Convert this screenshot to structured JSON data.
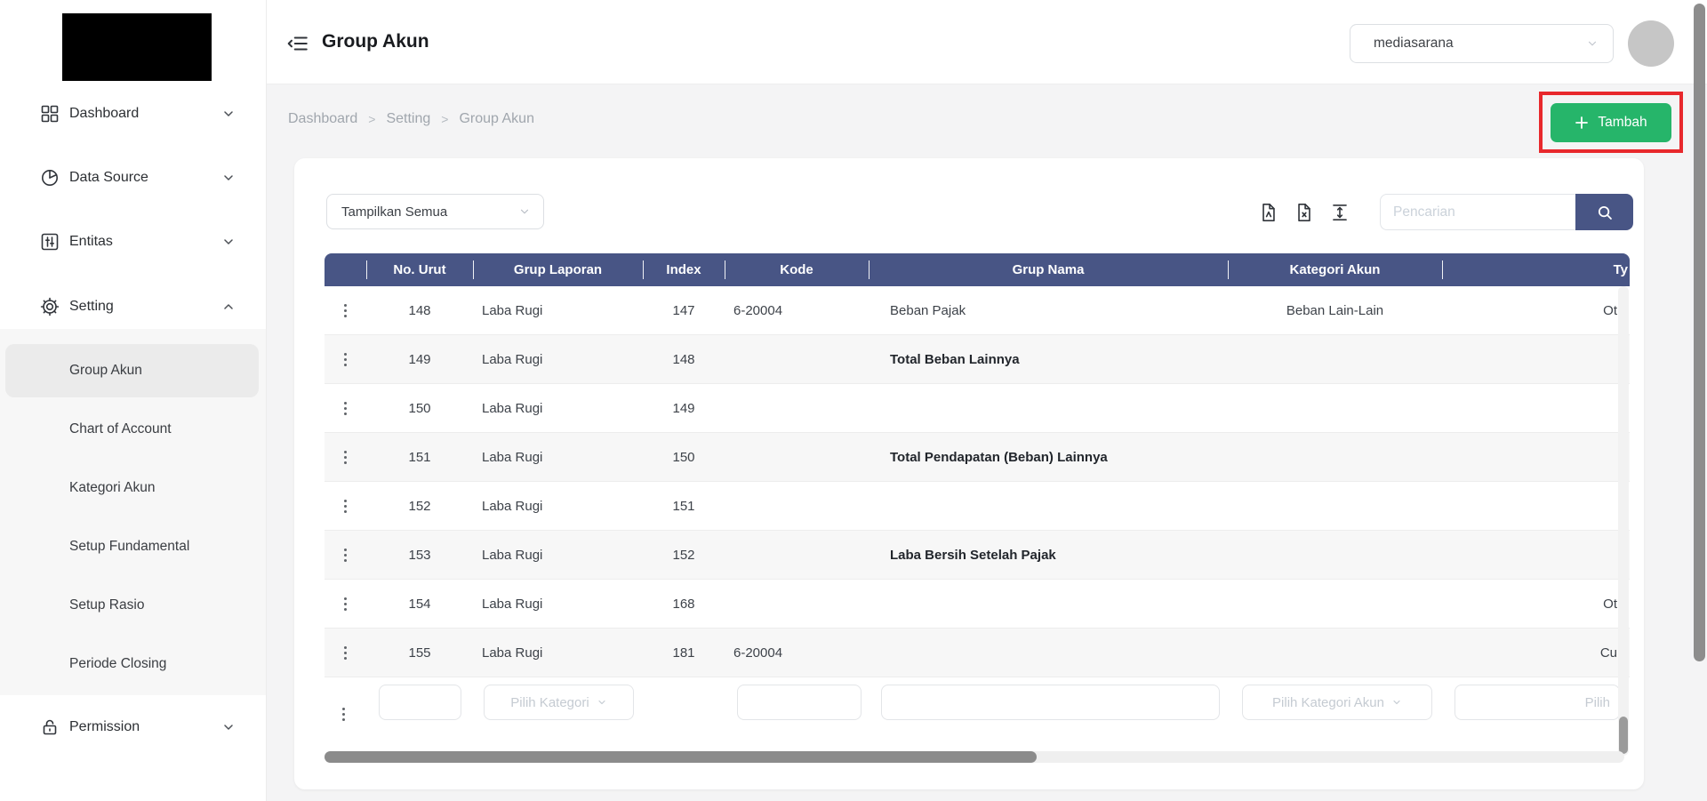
{
  "sidebar": {
    "items": [
      {
        "label": "Dashboard",
        "icon": "grid-icon"
      },
      {
        "label": "Data Source",
        "icon": "pie-chart-icon"
      },
      {
        "label": "Entitas",
        "icon": "sliders-icon"
      },
      {
        "label": "Setting",
        "icon": "gear-icon"
      },
      {
        "label": "Permission",
        "icon": "lock-icon"
      }
    ],
    "submenu": [
      {
        "label": "Group Akun",
        "active": true
      },
      {
        "label": "Chart of Account"
      },
      {
        "label": "Kategori Akun"
      },
      {
        "label": "Setup Fundamental"
      },
      {
        "label": "Setup Rasio"
      },
      {
        "label": "Periode Closing"
      }
    ]
  },
  "topbar": {
    "title": "Group Akun",
    "tenant": "mediasarana"
  },
  "breadcrumb": {
    "items": [
      "Dashboard",
      "Setting",
      "Group Akun"
    ],
    "separator": ">"
  },
  "actions": {
    "tambah": "Tambah"
  },
  "toolbar": {
    "show_filter": "Tampilkan Semua",
    "search_placeholder": "Pencarian"
  },
  "table": {
    "columns": {
      "no_urut": "No. Urut",
      "grup_laporan": "Grup Laporan",
      "index": "Index",
      "kode": "Kode",
      "grup_nama": "Grup Nama",
      "kategori_akun": "Kategori Akun",
      "type": "Ty"
    },
    "rows": [
      {
        "no_urut": "148",
        "grup_laporan": "Laba Rugi",
        "index": "147",
        "kode": "6-20004",
        "grup_nama": "Beban Pajak",
        "kategori_akun": "Beban Lain-Lain",
        "type": "Ot",
        "bold": false
      },
      {
        "no_urut": "149",
        "grup_laporan": "Laba Rugi",
        "index": "148",
        "kode": "",
        "grup_nama": "Total Beban Lainnya",
        "kategori_akun": "",
        "type": "",
        "bold": true
      },
      {
        "no_urut": "150",
        "grup_laporan": "Laba Rugi",
        "index": "149",
        "kode": "",
        "grup_nama": "",
        "kategori_akun": "",
        "type": "",
        "bold": false
      },
      {
        "no_urut": "151",
        "grup_laporan": "Laba Rugi",
        "index": "150",
        "kode": "",
        "grup_nama": "Total Pendapatan (Beban) Lainnya",
        "kategori_akun": "",
        "type": "",
        "bold": true
      },
      {
        "no_urut": "152",
        "grup_laporan": "Laba Rugi",
        "index": "151",
        "kode": "",
        "grup_nama": "",
        "kategori_akun": "",
        "type": "",
        "bold": false
      },
      {
        "no_urut": "153",
        "grup_laporan": "Laba Rugi",
        "index": "152",
        "kode": "",
        "grup_nama": "Laba Bersih Setelah Pajak",
        "kategori_akun": "",
        "type": "",
        "bold": true
      },
      {
        "no_urut": "154",
        "grup_laporan": "Laba Rugi",
        "index": "168",
        "kode": "",
        "grup_nama": "",
        "kategori_akun": "",
        "type": "Ot",
        "bold": false
      },
      {
        "no_urut": "155",
        "grup_laporan": "Laba Rugi",
        "index": "181",
        "kode": "6-20004",
        "grup_nama": "",
        "kategori_akun": "",
        "type": "Cu",
        "bold": false
      }
    ],
    "filters": {
      "grup_laporan_placeholder": "Pilih Kategori",
      "kategori_akun_placeholder": "Pilih Kategori Akun",
      "type_placeholder": "Pilih"
    }
  },
  "colors": {
    "indigo": "#485585",
    "green": "#26b56a",
    "red": "#e8282c"
  }
}
